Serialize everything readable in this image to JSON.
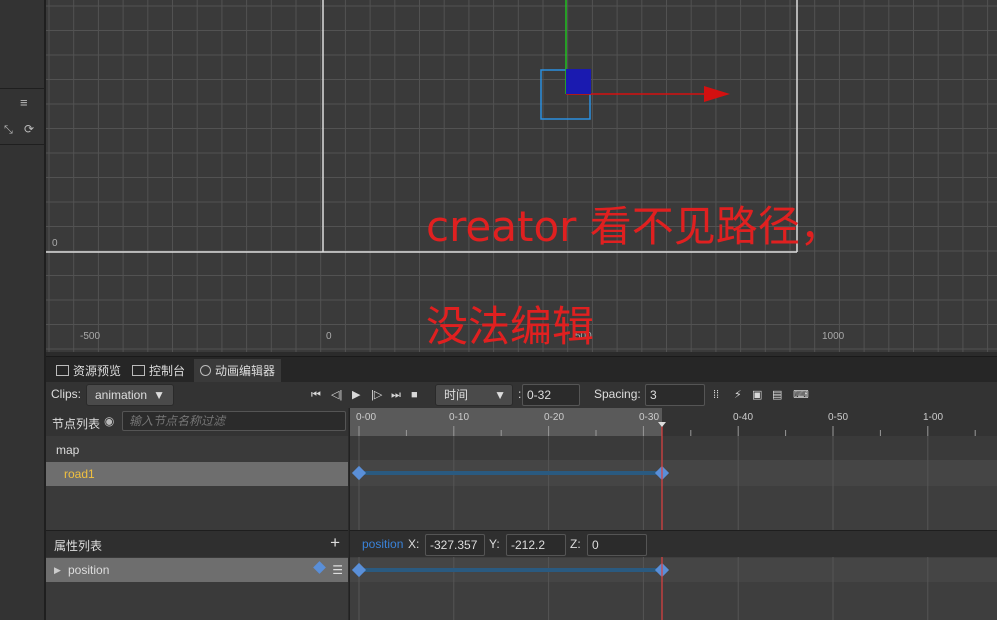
{
  "scene": {
    "ruler_x_labels": [
      "-500",
      "0",
      "500",
      "1000"
    ],
    "ruler_y_label": "0",
    "annotation_line1": "creator 看不见路径，",
    "annotation_line2": "没法编辑",
    "colors": {
      "annotation": "#e02020",
      "gizmo_x": "#d41010",
      "gizmo_y": "#20c020",
      "gizmo_center": "#1a1ab0",
      "selection": "#2a8fe0"
    }
  },
  "sidebar": {
    "menu_icon": "hamburger-icon",
    "collapse_icon": "collapse-icon",
    "refresh_icon": "refresh-icon"
  },
  "tabs": [
    {
      "label": "资源预览",
      "icon": "folder-icon"
    },
    {
      "label": "控制台",
      "icon": "console-icon"
    },
    {
      "label": "动画编辑器",
      "icon": "animation-icon"
    }
  ],
  "toolbar": {
    "clips_label": "Clips:",
    "clip_value": "animation",
    "time_mode": "时间",
    "current_time": "0-32",
    "spacing_label": "Spacing:",
    "spacing_value": "3",
    "colon": ":"
  },
  "node_list": {
    "header": "节点列表",
    "filter_placeholder": "输入节点名称过滤",
    "nodes": [
      "map",
      "road1"
    ]
  },
  "property_list": {
    "header": "属性列表",
    "add_symbol": "+",
    "items": [
      "position"
    ]
  },
  "timeline": {
    "ticks": [
      "0-00",
      "0-10",
      "0-20",
      "0-30",
      "0-40",
      "0-50",
      "1-00"
    ],
    "colors": {
      "keyframe": "#5a8fd8",
      "playhead": "#e04040",
      "track": "#2a5a80"
    }
  },
  "property_editor": {
    "name": "position",
    "x_label": "X:",
    "x_value": "-327.357",
    "y_label": "Y:",
    "y_value": "-212.2",
    "z_label": "Z:",
    "z_value": "0"
  }
}
